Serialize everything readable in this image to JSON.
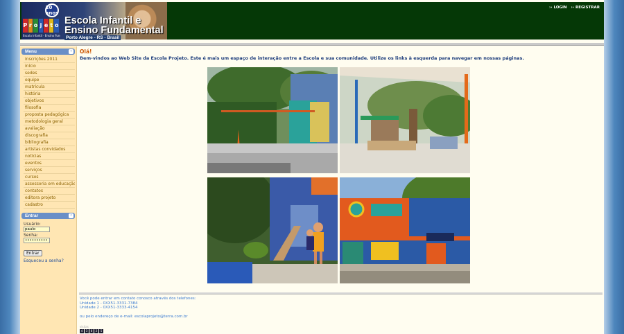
{
  "header": {
    "badge_text": "20 anos",
    "brand_letters": [
      "P",
      "r",
      "o",
      "j",
      "e",
      "t",
      "o"
    ],
    "brand_caption": "Escola Infantil · Ensino Fundamental",
    "title_line1": "Escola Infantil e",
    "title_line2": "Ensino Fundamental",
    "subtitle": "Porto Alegre - RS - Brasil",
    "login_link": "›› LOGIN",
    "register_link": "›› REGISTRAR"
  },
  "sidebar": {
    "menu_title": "Menu",
    "items": [
      "inscrições 2011",
      "início",
      "sedes",
      "equipe",
      "matrícula",
      "história",
      "objetivos",
      "filosofia",
      "proposta pedagógica",
      "metodologia geral",
      "avaliação",
      "discografia",
      "bibliografia",
      "artistas convidados",
      "notícias",
      "eventos",
      "serviços",
      "cursos",
      "assessoria em educação",
      "contatos",
      "editora projeto",
      "cadastro"
    ],
    "login_title": "Entrar",
    "username_label": "Usuário:",
    "username_value": "paulo",
    "password_label": "Senha:",
    "password_value": "••••••••••",
    "enter_button": "Entrar",
    "forgot_link": "Esqueceu a senha?"
  },
  "main": {
    "greeting": "Olá!",
    "welcome": "Bem-vindos ao Web Site da Escola Projeto. Este é mais um espaço de interação entre a Escola e sua comunidade. Utilize os links à esquerda para navegar em nossas páginas.",
    "contact_intro": "Você pode entrar em contato conosco através dos telefones:",
    "unit1": "Unidade 1 - 0XX51-3331-7384",
    "unit2": "Unidade 2 - 0XX51-3333-4154",
    "email_line": "ou pelo endereço de e-mail: escolaprojeto@terra.com.br",
    "counter_label": "visitas",
    "counter_digits": [
      "4",
      "3",
      "8",
      "2",
      "5"
    ]
  },
  "colors": {
    "header_green": "#053806",
    "sidebar_bg": "#ffe6b3",
    "menu_text": "#8a6200",
    "accent_blue": "#6a8fc7",
    "greeting_orange": "#cc5500",
    "page_bg": "#fffdf0"
  }
}
